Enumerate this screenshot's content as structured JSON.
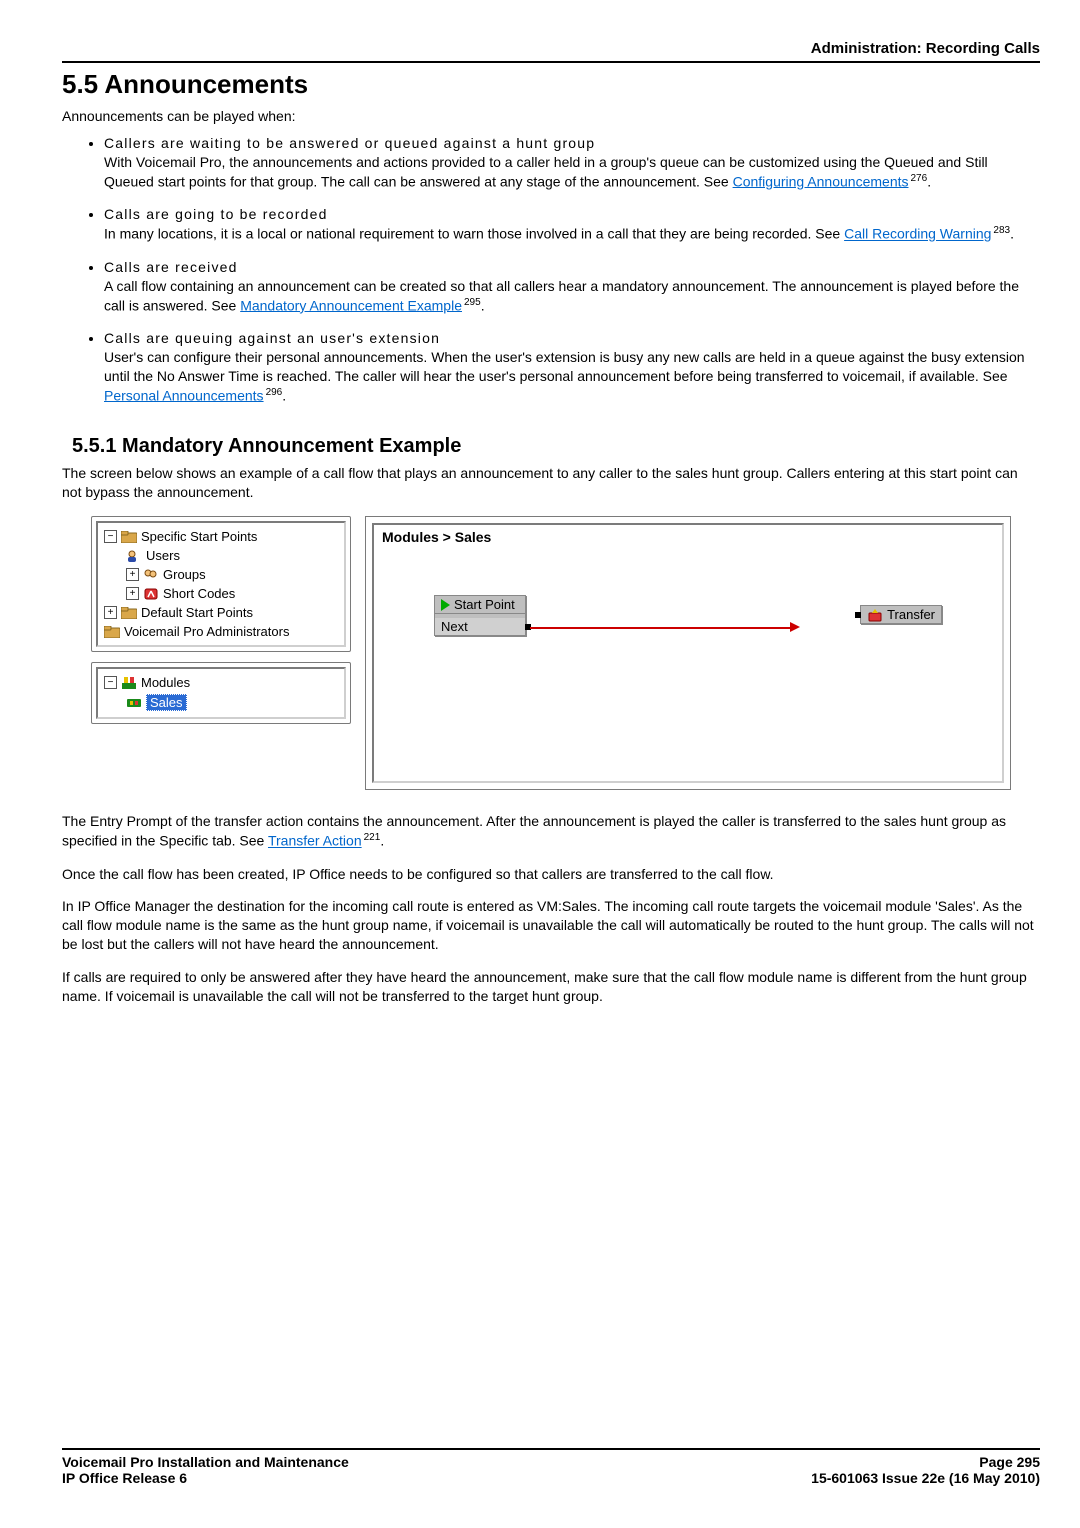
{
  "running_head": "Administration: Recording Calls",
  "section_number_title": "5.5 Announcements",
  "intro": "Announcements can be played when:",
  "bullets": [
    {
      "lead": "Callers are waiting to be answered or queued against a hunt group",
      "body_pre": "With Voicemail Pro, the announcements and actions provided to a caller held in a group's queue can be customized using the Queued and Still Queued start points for that group. The call can be answered at any stage of the announcement. See ",
      "link": "Configuring Announcements",
      "ref": "276",
      "body_post": "."
    },
    {
      "lead": "Calls are going to be recorded",
      "body_pre": "In many locations, it is a local or national requirement to warn those involved in a call that they are being recorded. See ",
      "link": "Call Recording Warning",
      "ref": "283",
      "body_post": "."
    },
    {
      "lead": "Calls are received",
      "body_pre": "A call flow containing an announcement can be created so that all callers hear a mandatory announcement. The announcement is played before the call is answered. See ",
      "link": "Mandatory Announcement Example",
      "ref": "295",
      "body_post": "."
    },
    {
      "lead": "Calls are queuing against an user's extension",
      "body_pre": "User's can configure their personal announcements. When the user's extension is busy any new calls are held in a queue against the busy extension until the No Answer Time is reached. The caller will hear the user's personal announcement before being transferred to voicemail, if available. See ",
      "link": "Personal Announcements",
      "ref": "296",
      "body_post": "."
    }
  ],
  "subsection_title": "5.5.1 Mandatory Announcement Example",
  "sub_intro": "The screen below shows an example of a call flow that plays an announcement to any caller to the sales hunt group. Callers entering at this start point can not bypass the announcement.",
  "tree_top": {
    "root": "Specific Start Points",
    "items": [
      "Users",
      "Groups",
      "Short Codes",
      "Default Start Points",
      "Voicemail Pro Administrators"
    ]
  },
  "tree_bottom": {
    "root": "Modules",
    "selected": "Sales"
  },
  "flow": {
    "breadcrumb": "Modules > Sales",
    "start_label": "Start Point",
    "start_sub": "Next",
    "transfer_label": "Transfer"
  },
  "after_para1_pre": "The Entry Prompt of the transfer action contains the announcement. After the announcement is played the caller is transferred to the sales hunt group as specified in the Specific tab. See ",
  "after_para1_link": "Transfer Action",
  "after_para1_ref": "221",
  "after_para1_post": ".",
  "after_para2": "Once the call flow has been created, IP Office needs to be configured so that callers are transferred to the call flow.",
  "after_para3": "In IP Office Manager the destination for the incoming call route is entered as VM:Sales. The incoming call route targets the voicemail module 'Sales'. As the call flow module name is the same as the hunt group name, if voicemail is unavailable the call will automatically be routed to the hunt group. The calls will not be lost but the callers will not have heard the announcement.",
  "after_para4": "If calls are required to only be answered after they have heard the announcement, make sure that the call flow module name is different from the hunt group name. If voicemail is unavailable the call will not be transferred to the target hunt group.",
  "footer": {
    "left1": "Voicemail Pro Installation and Maintenance",
    "left2": "IP Office Release 6",
    "right1": "Page 295",
    "right2": "15-601063 Issue 22e (16 May 2010)"
  }
}
